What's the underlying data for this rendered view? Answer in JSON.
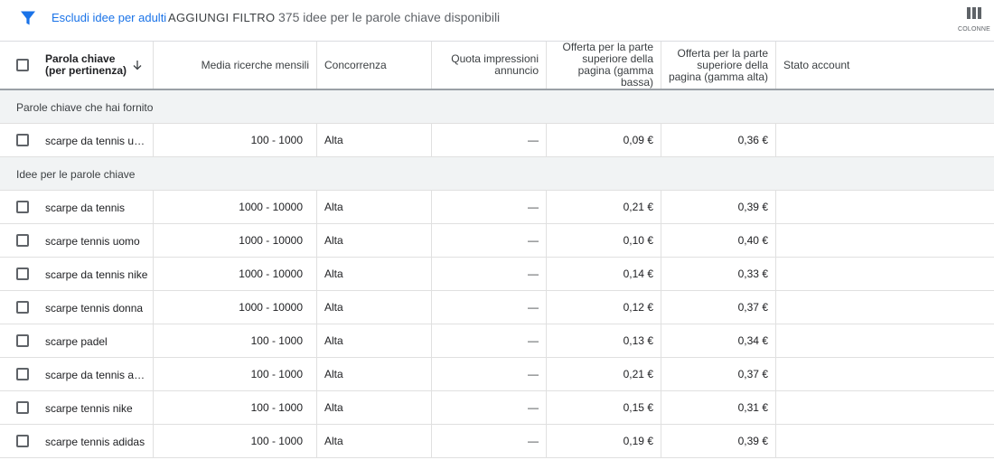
{
  "toolbar": {
    "filter_icon": "filter-funnel-icon",
    "exclude_adult": "Escludi idee per adulti",
    "add_filter": "AGGIUNGI FILTRO",
    "ideas_count": "375 idee per le parole chiave disponibili",
    "columns_icon": "columns-icon",
    "columns_label": "COLONNE"
  },
  "colors": {
    "accent": "#1a73e8",
    "group_background": "#f1f3f4",
    "border": "#e0e0e0"
  },
  "table": {
    "headers": {
      "keyword": "Parola chiave (per pertinenza)",
      "sort_icon": "arrow-down-icon",
      "avg_searches": "Media ricerche mensili",
      "competition": "Concorrenza",
      "impression_share": "Quota impressioni annuncio",
      "bid_low": "Offerta per la parte superiore della pagina (gamma bassa)",
      "bid_high": "Offerta per la parte superiore della pagina (gamma alta)",
      "account_status": "Stato account"
    },
    "groups": [
      {
        "label": "Parole chiave che hai fornito",
        "rows": [
          {
            "keyword": "scarpe da tennis uomo",
            "avg": "100 - 1000",
            "competition": "Alta",
            "share": "—",
            "low": "0,09 €",
            "high": "0,36 €",
            "status": ""
          }
        ]
      },
      {
        "label": "Idee per le parole chiave",
        "rows": [
          {
            "keyword": "scarpe da tennis",
            "avg": "1000 - 10000",
            "competition": "Alta",
            "share": "—",
            "low": "0,21 €",
            "high": "0,39 €",
            "status": ""
          },
          {
            "keyword": "scarpe tennis uomo",
            "avg": "1000 - 10000",
            "competition": "Alta",
            "share": "—",
            "low": "0,10 €",
            "high": "0,40 €",
            "status": ""
          },
          {
            "keyword": "scarpe da tennis nike",
            "avg": "1000 - 10000",
            "competition": "Alta",
            "share": "—",
            "low": "0,14 €",
            "high": "0,33 €",
            "status": ""
          },
          {
            "keyword": "scarpe tennis donna",
            "avg": "1000 - 10000",
            "competition": "Alta",
            "share": "—",
            "low": "0,12 €",
            "high": "0,37 €",
            "status": ""
          },
          {
            "keyword": "scarpe padel",
            "avg": "100 - 1000",
            "competition": "Alta",
            "share": "—",
            "low": "0,13 €",
            "high": "0,34 €",
            "status": ""
          },
          {
            "keyword": "scarpe da tennis adidas",
            "avg": "100 - 1000",
            "competition": "Alta",
            "share": "—",
            "low": "0,21 €",
            "high": "0,37 €",
            "status": ""
          },
          {
            "keyword": "scarpe tennis nike",
            "avg": "100 - 1000",
            "competition": "Alta",
            "share": "—",
            "low": "0,15 €",
            "high": "0,31 €",
            "status": ""
          },
          {
            "keyword": "scarpe tennis adidas",
            "avg": "100 - 1000",
            "competition": "Alta",
            "share": "—",
            "low": "0,19 €",
            "high": "0,39 €",
            "status": ""
          }
        ]
      }
    ]
  }
}
